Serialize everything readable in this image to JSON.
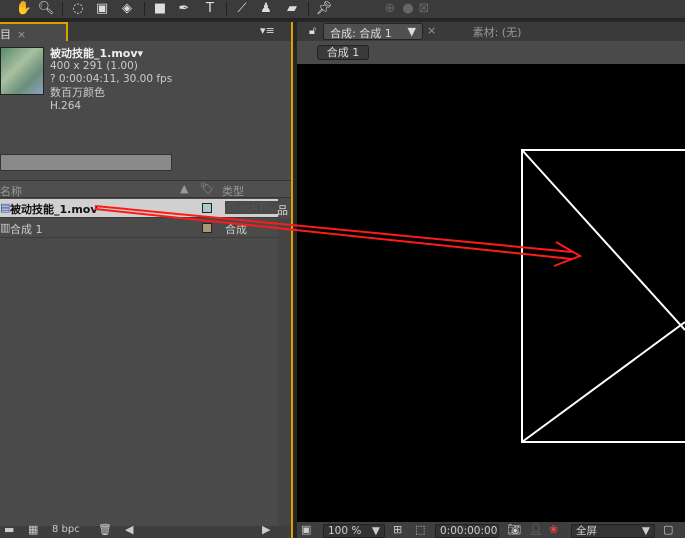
{
  "toolbar": {
    "icons": [
      "hand-icon",
      "zoom-icon",
      "rotate-icon",
      "camera-icon",
      "pan-behind-icon",
      "rectangle-icon",
      "pen-icon",
      "text-icon",
      "brush-icon",
      "stamp-icon",
      "eraser-icon",
      "puppet-pin-icon"
    ]
  },
  "project": {
    "tab_label": "目",
    "item_name": "被动技能_1.mov▾",
    "dimensions": "400 x 291 (1.00)",
    "duration": "? 0:00:04:11, 30.00 fps",
    "colors": "数百万颜色",
    "codec": "H.264",
    "col_name": "名称",
    "col_type": "类型",
    "rows": [
      {
        "name": "被动技能_1.mov",
        "type": "QuickTi...",
        "swatch": "#a8ccc8"
      },
      {
        "name": "合成 1",
        "type": "合成",
        "swatch": "#a89878"
      }
    ],
    "bpc": "8 bpc"
  },
  "comp": {
    "tab_label": "合成: 合成 1",
    "footage_tab": "素材: (无)",
    "breadcrumb": "合成 1",
    "zoom": "100 %",
    "timecode": "0:00:00:00",
    "resolution": "全屏"
  },
  "colors": {
    "accent": "#e2a000",
    "arrow": "#ff1a1a"
  }
}
